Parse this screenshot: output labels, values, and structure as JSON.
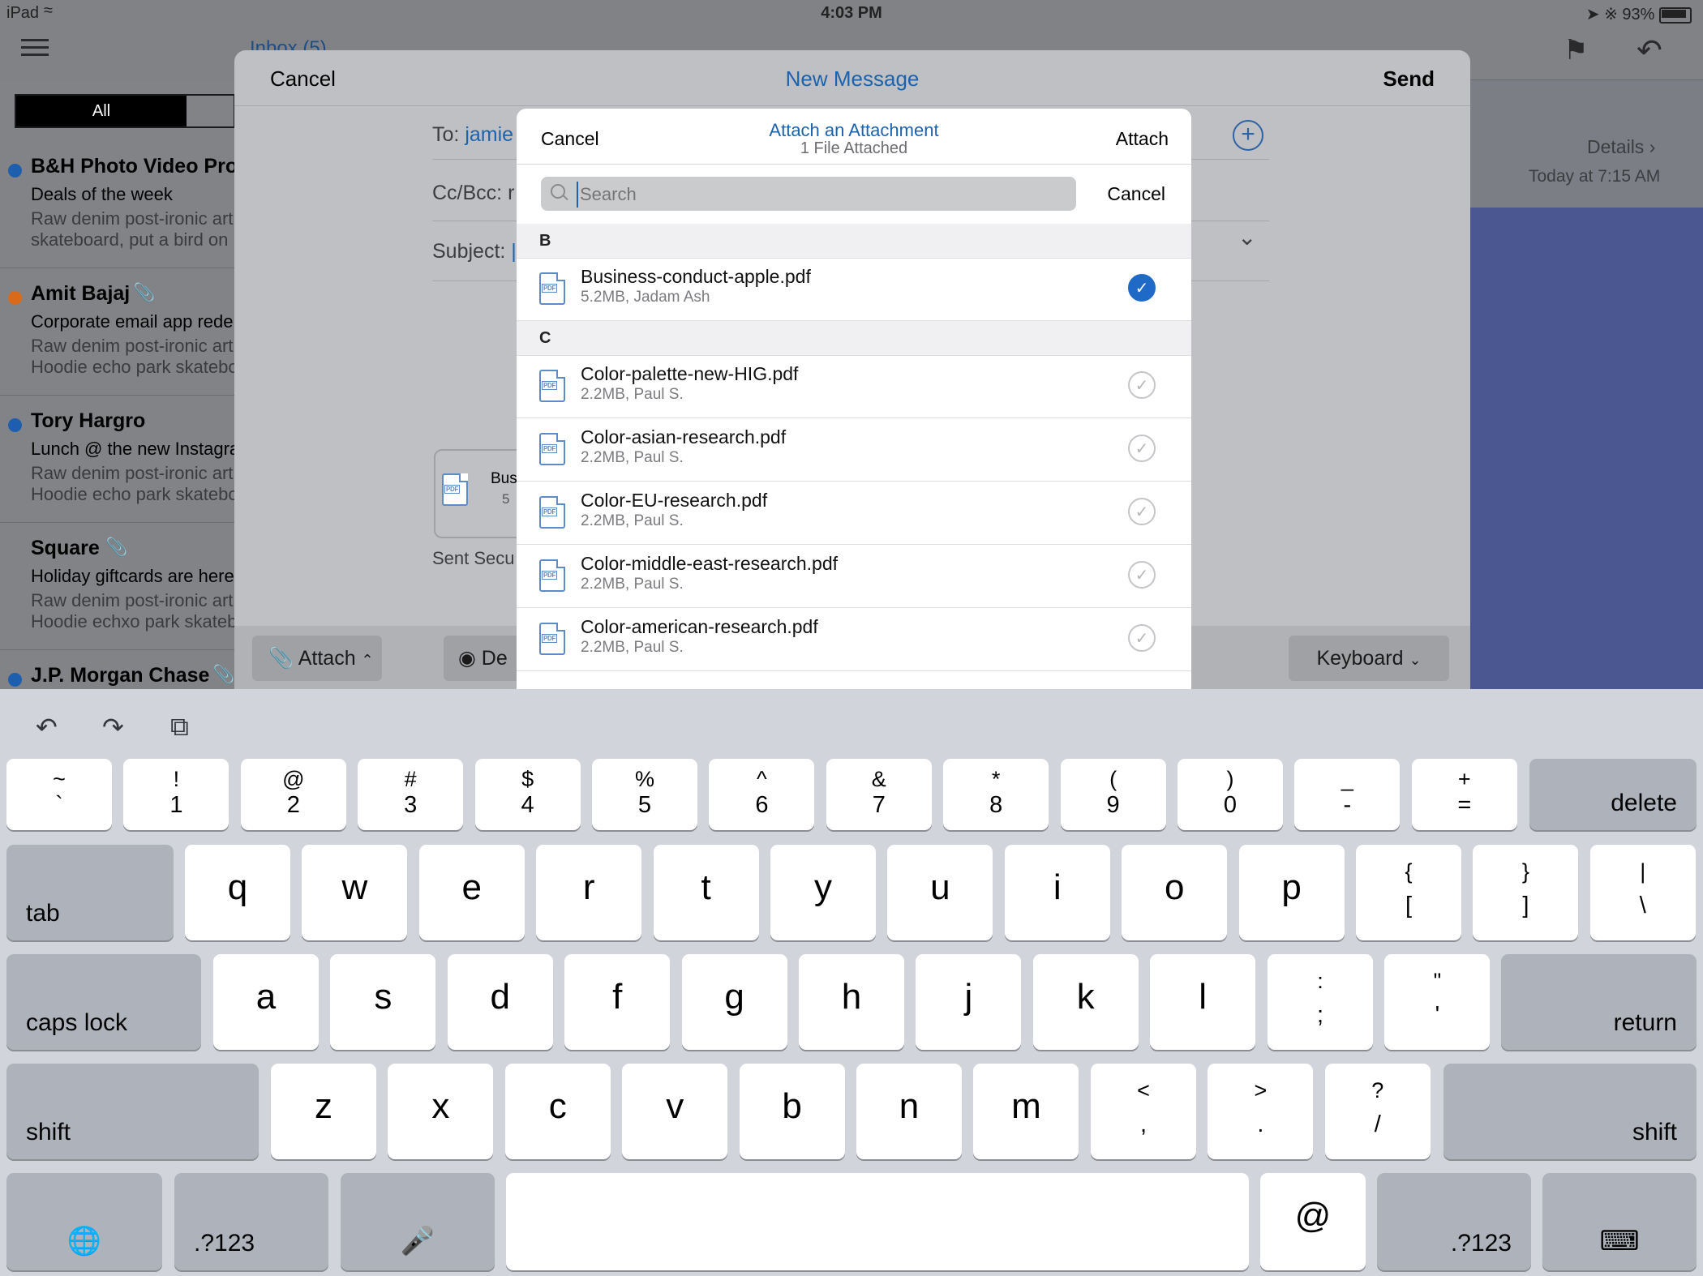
{
  "status": {
    "carrier": "iPad",
    "time": "4:03 PM",
    "battery": "93%"
  },
  "background": {
    "inbox_title": "Inbox (5)",
    "segment_all": "All",
    "mails": [
      {
        "sender": "B&H Photo Video Pro",
        "subject": "Deals of the week",
        "preview1": "Raw denim post-ironic art",
        "preview2": "skateboard, put a bird on",
        "dot": "#1d5fae"
      },
      {
        "sender": "Amit Bajaj",
        "subject": "Corporate email app rede",
        "preview1": "Raw denim post-ironic art",
        "preview2": "Hoodie echo park skatebo",
        "dot": "#d96a1a"
      },
      {
        "sender": "Tory Hargro",
        "subject": "Lunch @ the new Instagra",
        "preview1": "Raw denim post-ironic art",
        "preview2": "Hoodie echo park skatebo",
        "dot": "#1d5fae"
      },
      {
        "sender": "Square",
        "subject": "Holiday giftcards are here",
        "preview1": "Raw denim post-ironic art",
        "preview2": "Hoodie echxo park skateb",
        "dot": ""
      },
      {
        "sender": "J.P. Morgan Chase",
        "subject": "",
        "preview1": "",
        "preview2": "",
        "dot": "#1d5fae"
      }
    ],
    "details_label": "Details",
    "details_date": "Today at 7:15 AM"
  },
  "compose": {
    "cancel": "Cancel",
    "title": "New Message",
    "send": "Send",
    "to_label": "To:",
    "to_value": "jamie",
    "cc_label": "Cc/Bcc:",
    "cc_value": "r",
    "subject_label": "Subject:",
    "attachment_name": "Bus",
    "attachment_size": "5",
    "sent_text": "Sent Secu",
    "attach_button": "Attach",
    "details_button": "De",
    "keyboard_button": "Keyboard"
  },
  "picker": {
    "cancel": "Cancel",
    "title": "Attach an Attachment",
    "subtitle": "1 File Attached",
    "attach": "Attach",
    "search_placeholder": "Search",
    "search_cancel": "Cancel",
    "sections": [
      {
        "letter": "B",
        "files": [
          {
            "name": "Business-conduct-apple.pdf",
            "meta": "5.2MB, Jadam Ash",
            "checked": true
          }
        ]
      },
      {
        "letter": "C",
        "files": [
          {
            "name": "Color-palette-new-HIG.pdf",
            "meta": "2.2MB, Paul S.",
            "checked": false
          },
          {
            "name": "Color-asian-research.pdf",
            "meta": "2.2MB, Paul S.",
            "checked": false
          },
          {
            "name": "Color-EU-research.pdf",
            "meta": "2.2MB, Paul S.",
            "checked": false
          },
          {
            "name": "Color-middle-east-research.pdf",
            "meta": "2.2MB, Paul S.",
            "checked": false
          },
          {
            "name": "Color-american-research.pdf",
            "meta": "2.2MB, Paul S.",
            "checked": false
          }
        ]
      }
    ],
    "pdf_badge": "PDF"
  },
  "keyboard": {
    "number_row": [
      [
        "~",
        "`"
      ],
      [
        "!",
        "1"
      ],
      [
        "@",
        "2"
      ],
      [
        "#",
        "3"
      ],
      [
        "$",
        "4"
      ],
      [
        "%",
        "5"
      ],
      [
        "^",
        "6"
      ],
      [
        "&",
        "7"
      ],
      [
        "*",
        "8"
      ],
      [
        "(",
        "9"
      ],
      [
        ")",
        "0"
      ],
      [
        "_",
        "-"
      ],
      [
        "+",
        "="
      ]
    ],
    "delete": "delete",
    "tab": "tab",
    "row1": [
      "q",
      "w",
      "e",
      "r",
      "t",
      "y",
      "u",
      "i",
      "o",
      "p"
    ],
    "row1_sym": [
      [
        "{",
        "["
      ],
      [
        "}",
        "]"
      ],
      [
        "|",
        "\\"
      ]
    ],
    "caps": "caps lock",
    "row2": [
      "a",
      "s",
      "d",
      "f",
      "g",
      "h",
      "j",
      "k",
      "l"
    ],
    "row2_sym": [
      [
        ":",
        ";"
      ],
      [
        "\"",
        "'"
      ]
    ],
    "return": "return",
    "shift": "shift",
    "row3": [
      "z",
      "x",
      "c",
      "v",
      "b",
      "n",
      "m"
    ],
    "row3_sym": [
      [
        "<",
        ","
      ],
      [
        ">",
        "."
      ],
      [
        "?",
        "/"
      ]
    ],
    "num_label": ".?123",
    "at": "@"
  }
}
